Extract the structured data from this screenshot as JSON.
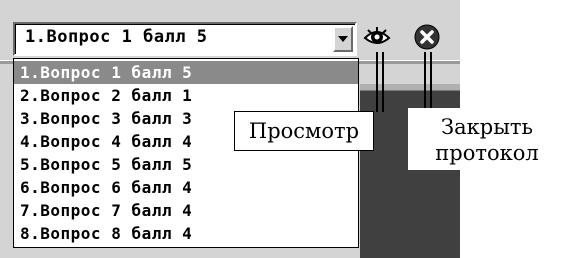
{
  "combo": {
    "selected": "1.Вопрос 1 балл 5"
  },
  "dropdown": {
    "items": [
      "1.Вопрос 1 балл 5",
      "2.Вопрос 2 балл 1",
      "3.Вопрос 3 балл 3",
      "4.Вопрос 4 балл 4",
      "5.Вопрос 5 балл 5",
      "6.Вопрос 6 балл 4",
      "7.Вопрос 7 балл 4",
      "8.Вопрос 8 балл 4"
    ],
    "selected_index": 0
  },
  "callouts": {
    "view": "Просмотр",
    "close_line1": "Закрыть",
    "close_line2": "протокол"
  },
  "icons": {
    "view": "eye-icon",
    "close": "close-icon",
    "dropdown": "chevron-down-icon"
  },
  "colors": {
    "panel": "#d4d4d4",
    "selection": "#8a8a8a",
    "dark": "#404040"
  }
}
